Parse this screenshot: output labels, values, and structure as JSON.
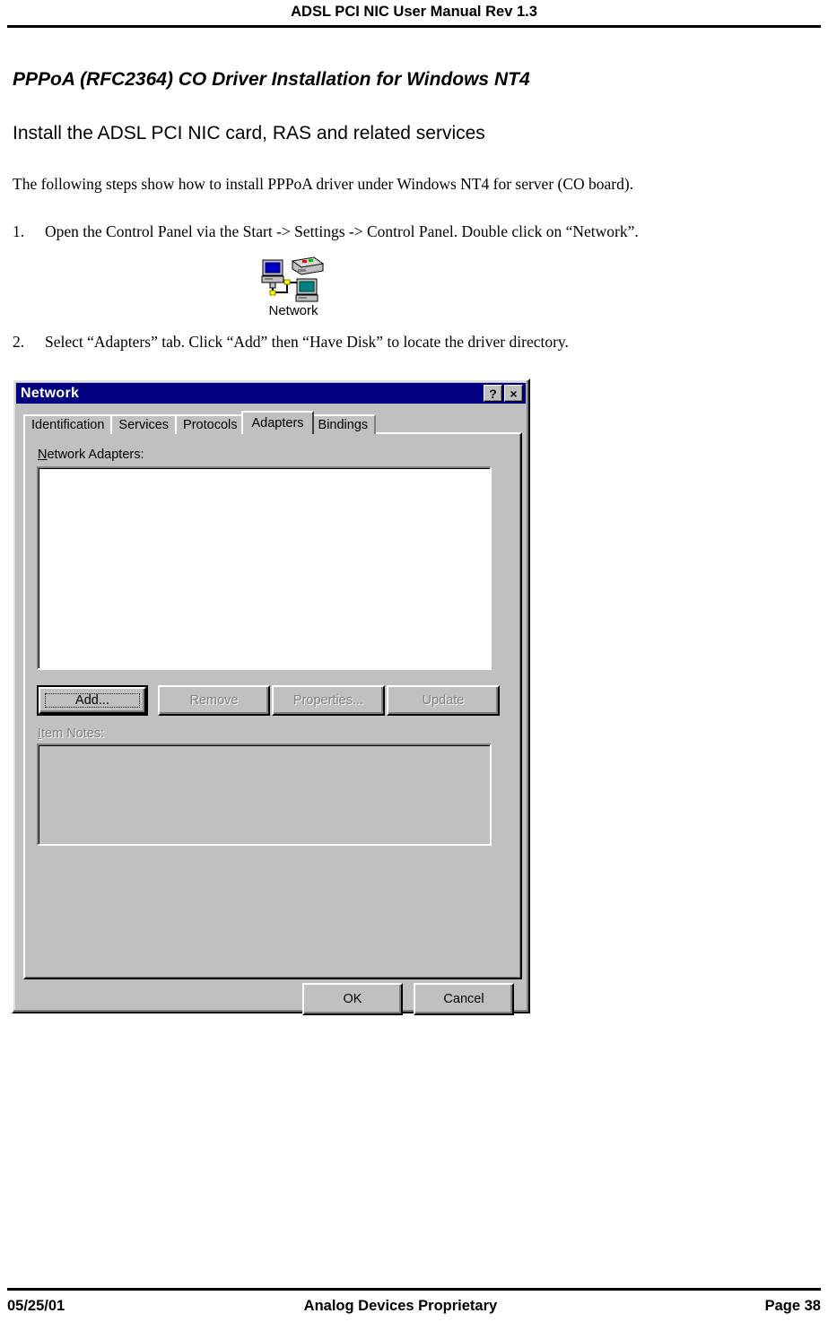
{
  "page_header": {
    "title": "ADSL PCI NIC User Manual Rev 1.3"
  },
  "content": {
    "heading1": "PPPoA (RFC2364) CO Driver Installation for Windows NT4",
    "heading2": "Install the ADSL PCI NIC card, RAS and related services",
    "intro": "The following steps show how to install PPPoA driver under Windows NT4 for server (CO board).",
    "steps": [
      {
        "number": "1.",
        "text": "Open the Control Panel via the Start -> Settings -> Control Panel.  Double click on “Network”."
      },
      {
        "number": "2.",
        "text": "Select “Adapters” tab.  Click “Add” then “Have Disk” to locate the driver directory."
      }
    ]
  },
  "network_icon": {
    "icon": "network-computers-icon",
    "label": "Network"
  },
  "dialog": {
    "title": "Network",
    "titlebar_color": "#000080",
    "face_color": "#c0c0c0",
    "help_button": "?",
    "close_button": "×",
    "tabs": [
      {
        "label": "Identification",
        "active": false
      },
      {
        "label": "Services",
        "active": false
      },
      {
        "label": "Protocols",
        "active": false
      },
      {
        "label": "Adapters",
        "active": true
      },
      {
        "label": "Bindings",
        "active": false
      }
    ],
    "adapters_label_accel": "N",
    "adapters_label_rest": "etwork Adapters:",
    "adapters_list": [],
    "buttons": [
      {
        "label": "Add...",
        "state": "default-focused"
      },
      {
        "label": "Remove",
        "state": "disabled"
      },
      {
        "label": "Properties...",
        "state": "disabled"
      },
      {
        "label": "Update",
        "state": "disabled"
      }
    ],
    "notes_label_accel": "I",
    "notes_label_rest": "tem Notes:",
    "notes_value": "",
    "ok_label": "OK",
    "cancel_label": "Cancel"
  },
  "page_footer": {
    "date": "05/25/01",
    "center": "Analog Devices Proprietary",
    "page": "Page 38"
  }
}
